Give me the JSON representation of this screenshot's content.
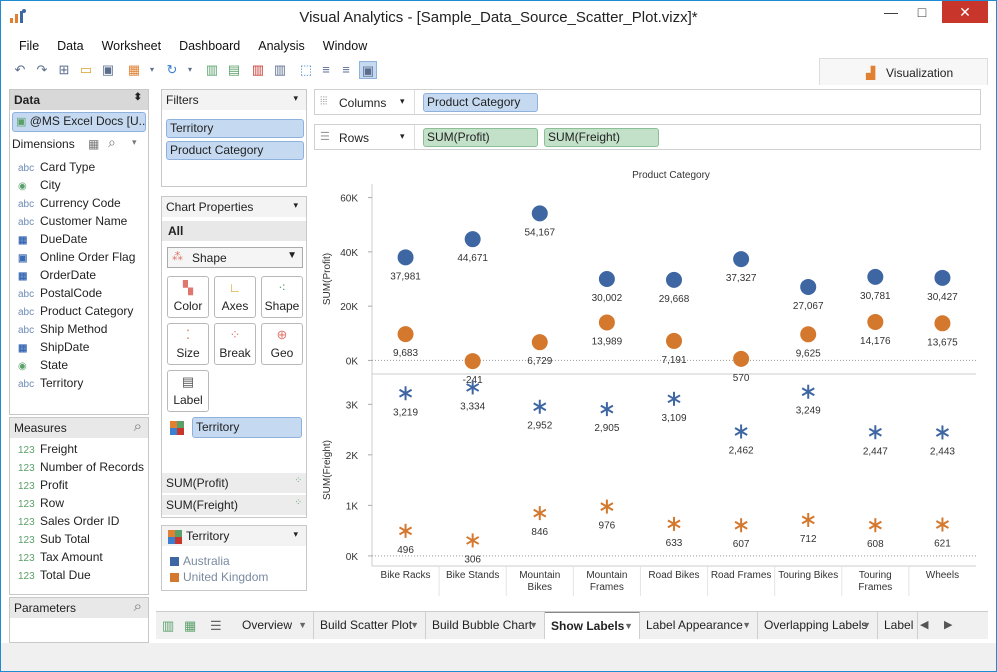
{
  "window": {
    "title": "Visual Analytics - [Sample_Data_Source_Scatter_Plot.vizx]*"
  },
  "menu": [
    "File",
    "Data",
    "Worksheet",
    "Dashboard",
    "Analysis",
    "Window"
  ],
  "visualization_tab": "Visualization",
  "data_pane": {
    "header": "Data",
    "source": "@MS Excel Docs [U...",
    "dimensions_label": "Dimensions",
    "dimensions": [
      {
        "type": "abc",
        "name": "Card Type"
      },
      {
        "type": "geo",
        "name": "City"
      },
      {
        "type": "abc",
        "name": "Currency Code"
      },
      {
        "type": "abc",
        "name": "Customer Name"
      },
      {
        "type": "cal",
        "name": "DueDate"
      },
      {
        "type": "bool",
        "name": "Online Order Flag"
      },
      {
        "type": "cal",
        "name": "OrderDate"
      },
      {
        "type": "abc",
        "name": "PostalCode"
      },
      {
        "type": "abc",
        "name": "Product Category"
      },
      {
        "type": "abc",
        "name": "Ship Method"
      },
      {
        "type": "cal",
        "name": "ShipDate"
      },
      {
        "type": "geo",
        "name": "State"
      },
      {
        "type": "abc",
        "name": "Territory"
      }
    ],
    "measures_label": "Measures",
    "measures": [
      {
        "type": "123",
        "name": "Freight"
      },
      {
        "type": "123",
        "name": "Number of Records"
      },
      {
        "type": "123",
        "name": "Profit"
      },
      {
        "type": "123",
        "name": "Row"
      },
      {
        "type": "123",
        "name": "Sales Order ID"
      },
      {
        "type": "123",
        "name": "Sub Total"
      },
      {
        "type": "123",
        "name": "Tax Amount"
      },
      {
        "type": "123",
        "name": "Total Due"
      }
    ],
    "parameters_label": "Parameters"
  },
  "filters": {
    "header": "Filters",
    "items": [
      "Territory",
      "Product Category"
    ]
  },
  "chart_properties": {
    "header": "Chart Properties",
    "scope": "All",
    "mark_type": "Shape",
    "cards": [
      "Color",
      "Axes",
      "Shape",
      "Size",
      "Break",
      "Geo",
      "Label"
    ],
    "color_pill": "Territory",
    "measure_tabs": [
      "SUM(Profit)",
      "SUM(Freight)"
    ]
  },
  "legend": {
    "header": "Territory",
    "items": [
      {
        "name": "Australia",
        "color": "#3e66a2"
      },
      {
        "name": "United Kingdom",
        "color": "#d4782e"
      }
    ]
  },
  "shelves": {
    "columns_label": "Columns",
    "columns_pills": [
      "Product Category"
    ],
    "rows_label": "Rows",
    "rows_pills": [
      "SUM(Profit)",
      "SUM(Freight)"
    ]
  },
  "chart_data": {
    "type": "scatter",
    "title": "Product Category",
    "categories": [
      "Bike Racks",
      "Bike Stands",
      "Mountain Bikes",
      "Mountain Frames",
      "Road Bikes",
      "Road Frames",
      "Touring Bikes",
      "Touring Frames",
      "Wheels"
    ],
    "panels": [
      {
        "ylabel": "SUM(Profit)",
        "ylim": [
          -5000,
          65000
        ],
        "ticks": [
          0,
          20000,
          40000,
          60000
        ],
        "tick_labels": [
          "0K",
          "20K",
          "40K",
          "60K"
        ],
        "marker": "circle",
        "series": [
          {
            "name": "Australia",
            "values": [
              37981,
              44671,
              54167,
              30002,
              29668,
              37327,
              27067,
              30781,
              30427
            ],
            "labels": [
              "37,981",
              "44,671",
              "54,167",
              "30,002",
              "29,668",
              "37,327",
              "27,067",
              "30,781",
              "30,427"
            ]
          },
          {
            "name": "United Kingdom",
            "values": [
              9683,
              -241,
              6729,
              13989,
              7191,
              570,
              9625,
              14176,
              13675
            ],
            "labels": [
              "9,683",
              "-241",
              "6,729",
              "13,989",
              "7,191",
              "570",
              "9,625",
              "14,176",
              "13,675"
            ]
          }
        ]
      },
      {
        "ylabel": "SUM(Freight)",
        "ylim": [
          -200,
          3600
        ],
        "ticks": [
          0,
          1000,
          2000,
          3000
        ],
        "tick_labels": [
          "0K",
          "1K",
          "2K",
          "3K"
        ],
        "marker": "asterisk",
        "series": [
          {
            "name": "Australia",
            "values": [
              3219,
              3334,
              2952,
              2905,
              3109,
              2462,
              3249,
              2447,
              2443
            ],
            "labels": [
              "3,219",
              "3,334",
              "2,952",
              "2,905",
              "3,109",
              "2,462",
              "3,249",
              "2,447",
              "2,443"
            ]
          },
          {
            "name": "United Kingdom",
            "values": [
              496,
              306,
              846,
              976,
              633,
              607,
              712,
              608,
              621
            ],
            "labels": [
              "496",
              "306",
              "846",
              "976",
              "633",
              "607",
              "712",
              "608",
              "621"
            ]
          }
        ]
      }
    ]
  },
  "sheet_tabs": [
    "Overview",
    "Build Scatter Plot",
    "Build Bubble Chart",
    "Show Labels",
    "Label Appearance",
    "Overlapping Labels",
    "Label"
  ],
  "active_sheet": "Show Labels"
}
